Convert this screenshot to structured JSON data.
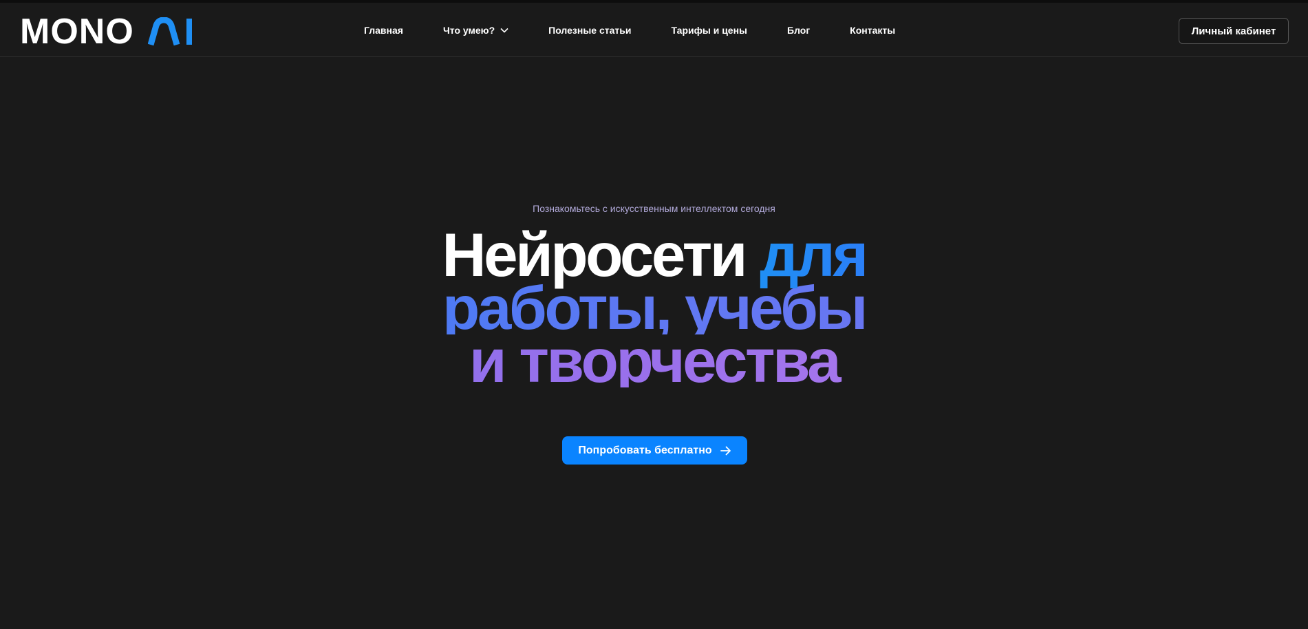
{
  "brand": {
    "logo_text": "MONO",
    "logo_ai_text": "AI",
    "accent_color": "#1f8ff4"
  },
  "nav": {
    "items": [
      {
        "label": "Главная"
      },
      {
        "label": "Что умею?",
        "has_dropdown": true
      },
      {
        "label": "Полезные статьи"
      },
      {
        "label": "Тарифы и цены"
      },
      {
        "label": "Блог"
      },
      {
        "label": "Контакты"
      }
    ],
    "cabinet_label": "Личный кабинет"
  },
  "hero": {
    "eyebrow": "Познакомьтесь с искусственным интеллектом сегодня",
    "headline": {
      "line1_white": "Нейросети",
      "line1_colored": "для",
      "line2": "работы, учебы",
      "line3": "и творчества"
    },
    "cta_label": "Попробовать бесплатно",
    "cta_color": "#0a84ff"
  },
  "icons": {
    "dropdown": "chevron-down-icon",
    "cta": "arrow-right-icon"
  }
}
